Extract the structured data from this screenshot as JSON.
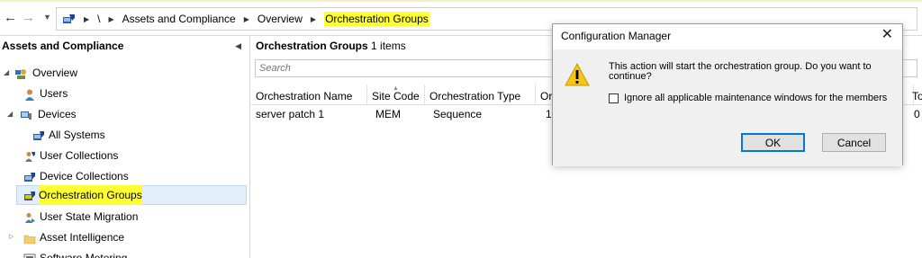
{
  "address_bar": {
    "back_icon": "arrow-left-icon",
    "forward_icon": "arrow-right-icon",
    "dropdown_icon": "chevron-down-icon",
    "root_icon": "console-root-icon",
    "root_label": "\\",
    "breadcrumbs": [
      "Assets and Compliance",
      "Overview",
      "Orchestration Groups"
    ],
    "highlight_color": "#ffff33"
  },
  "left_pane": {
    "title": "Assets and Compliance",
    "collapse_icon": "chevron-left-icon",
    "tree": [
      {
        "label": "Overview",
        "icon": "overview-icon",
        "expanded": true
      },
      {
        "label": "Users",
        "icon": "users-icon"
      },
      {
        "label": "Devices",
        "icon": "devices-icon",
        "expanded": true
      },
      {
        "label": "All Systems",
        "icon": "collection-icon"
      },
      {
        "label": "User Collections",
        "icon": "user-collections-icon"
      },
      {
        "label": "Device Collections",
        "icon": "device-collections-icon"
      },
      {
        "label": "Orchestration Groups",
        "icon": "orchestration-groups-icon",
        "selected": true
      },
      {
        "label": "User State Migration",
        "icon": "user-state-migration-icon"
      },
      {
        "label": "Asset Intelligence",
        "icon": "folder-icon",
        "expanded": false
      },
      {
        "label": "Software Metering",
        "icon": "software-metering-icon"
      }
    ]
  },
  "main": {
    "title": "Orchestration Groups",
    "count_text": "1 items",
    "search_placeholder": "Search",
    "columns": [
      "Orchestration Name",
      "Site Code",
      "Orchestration Type",
      "Or",
      "To"
    ],
    "rows": [
      [
        "server patch 1",
        "MEM",
        "Sequence",
        "1",
        "0"
      ]
    ]
  },
  "dialog": {
    "title": "Configuration Manager",
    "close_icon": "close-icon",
    "warning_icon": "warning-icon",
    "message": "This action will start the orchestration group. Do you want to continue?",
    "checkbox_label": "Ignore all applicable maintenance windows for the members",
    "checkbox_checked": false,
    "ok_label": "OK",
    "cancel_label": "Cancel"
  }
}
